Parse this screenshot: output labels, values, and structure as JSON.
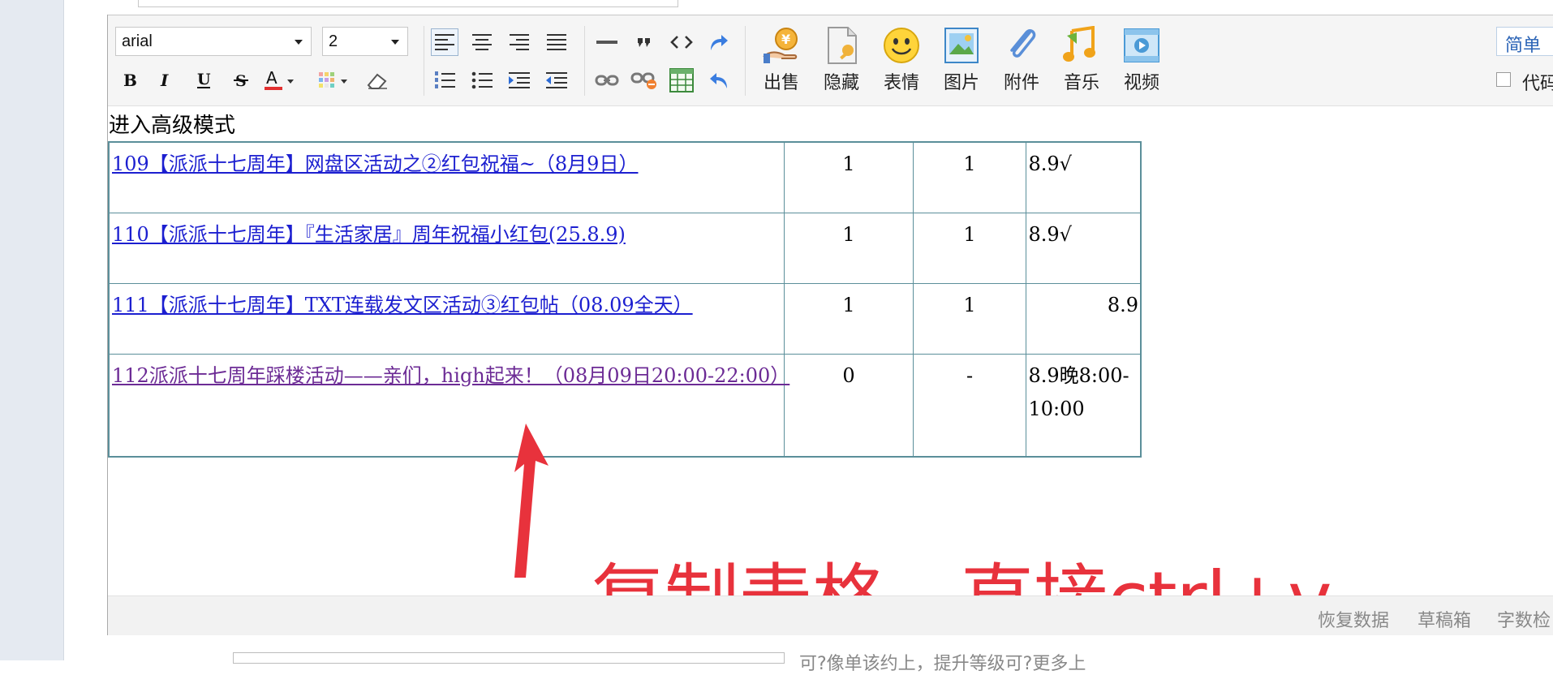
{
  "editor": {
    "font_family": "arial",
    "font_size": "2",
    "mode_toggle": "简单",
    "code_checkbox": "代码",
    "advanced_mode": "进入高级模式"
  },
  "toolbar": {
    "icons": [
      "align-left-icon",
      "align-center-icon",
      "align-right-icon",
      "align-justify-icon",
      "horizontal-rule-icon",
      "quote-icon",
      "code-icon",
      "redo-icon",
      "bold-icon",
      "italic-icon",
      "underline-icon",
      "strikethrough-icon",
      "text-color-icon",
      "background-color-icon",
      "eraser-icon",
      "ordered-list-icon",
      "unordered-list-icon",
      "indent-icon",
      "outdent-icon",
      "link-icon",
      "unlink-icon",
      "table-icon",
      "undo-icon"
    ],
    "big_buttons": [
      {
        "label": "出售",
        "icon": "sell-icon"
      },
      {
        "label": "隐藏",
        "icon": "hide-icon"
      },
      {
        "label": "表情",
        "icon": "emoji-icon"
      },
      {
        "label": "图片",
        "icon": "image-icon"
      },
      {
        "label": "附件",
        "icon": "attachment-icon"
      },
      {
        "label": "音乐",
        "icon": "music-icon"
      },
      {
        "label": "视频",
        "icon": "video-icon"
      }
    ]
  },
  "table": {
    "rows": [
      {
        "title": "109【派派十七周年】网盘区活动之②红包祝福~（8月9日）",
        "c1": "1",
        "c2": "1",
        "c3": "8.9√",
        "visited": false
      },
      {
        "title": "110【派派十七周年】『生活家居』周年祝福小红包(25.8.9)",
        "c1": "1",
        "c2": "1",
        "c3": "8.9√",
        "visited": false
      },
      {
        "title": "111【派派十七周年】TXT连载发文区活动③红包帖（08.09全天）",
        "c1": "1",
        "c2": "1",
        "c3": "8.9",
        "visited": false
      },
      {
        "title": "112派派十七周年踩楼活动——亲们，high起来！（08月09日20:00-22:00）",
        "c1": "0",
        "c2": "-",
        "c3": "8.9晚8:00-10:00",
        "visited": true
      }
    ]
  },
  "annotation": {
    "text": "复制表格，直接ctrl+v",
    "color": "#e8323c"
  },
  "statusbar": {
    "restore": "恢复数据",
    "drafts": "草稿箱",
    "wordcount": "字数检"
  },
  "below": {
    "text": "可?像单该约上，提升等级可?更多上"
  }
}
